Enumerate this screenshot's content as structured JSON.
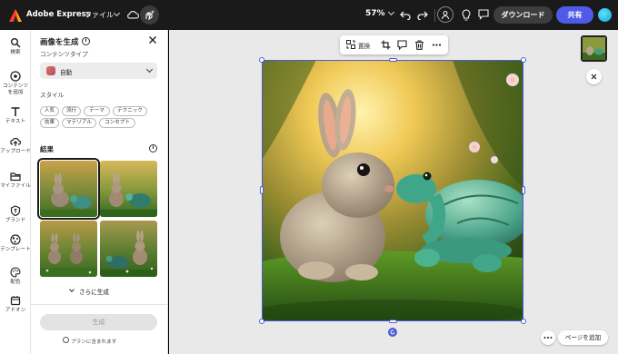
{
  "app": {
    "name": "Adobe Express"
  },
  "topbar": {
    "file_menu": "ファイル",
    "zoom": "57%",
    "download": "ダウンロード",
    "share": "共有"
  },
  "rail": {
    "items": [
      {
        "label": "検索",
        "icon": "search-icon"
      },
      {
        "label": "コンテンツを追加",
        "icon": "add-content-icon"
      },
      {
        "label": "テキスト",
        "icon": "text-icon"
      },
      {
        "label": "アップロード",
        "icon": "upload-icon"
      },
      {
        "label": "マイファイル",
        "icon": "folder-icon"
      },
      {
        "label": "ブランド",
        "icon": "brand-icon"
      },
      {
        "label": "テンプレート",
        "icon": "template-icon"
      },
      {
        "label": "配色",
        "icon": "palette-icon"
      },
      {
        "label": "アドオン",
        "icon": "addon-icon"
      }
    ]
  },
  "panel": {
    "title": "画像を生成",
    "content_type_label": "コンテンツタイプ",
    "content_type_value": "自動",
    "style_label": "スタイル",
    "style_chips": [
      "人気",
      "流行",
      "テーマ",
      "テクニック",
      "効果",
      "マテリアル",
      "コンセプト"
    ],
    "results_label": "結果",
    "more_generate": "さらに生成",
    "generate_button": "生成",
    "plan_note": "プランに含まれます"
  },
  "canvas": {
    "toolbar": {
      "replace": "置換"
    },
    "add_page": "ページを追加"
  },
  "colors": {
    "accent": "#4f5be8",
    "selection": "#4b5bd8",
    "topbar": "#1a1a1a",
    "canvas_bg": "#e9e9e9"
  }
}
